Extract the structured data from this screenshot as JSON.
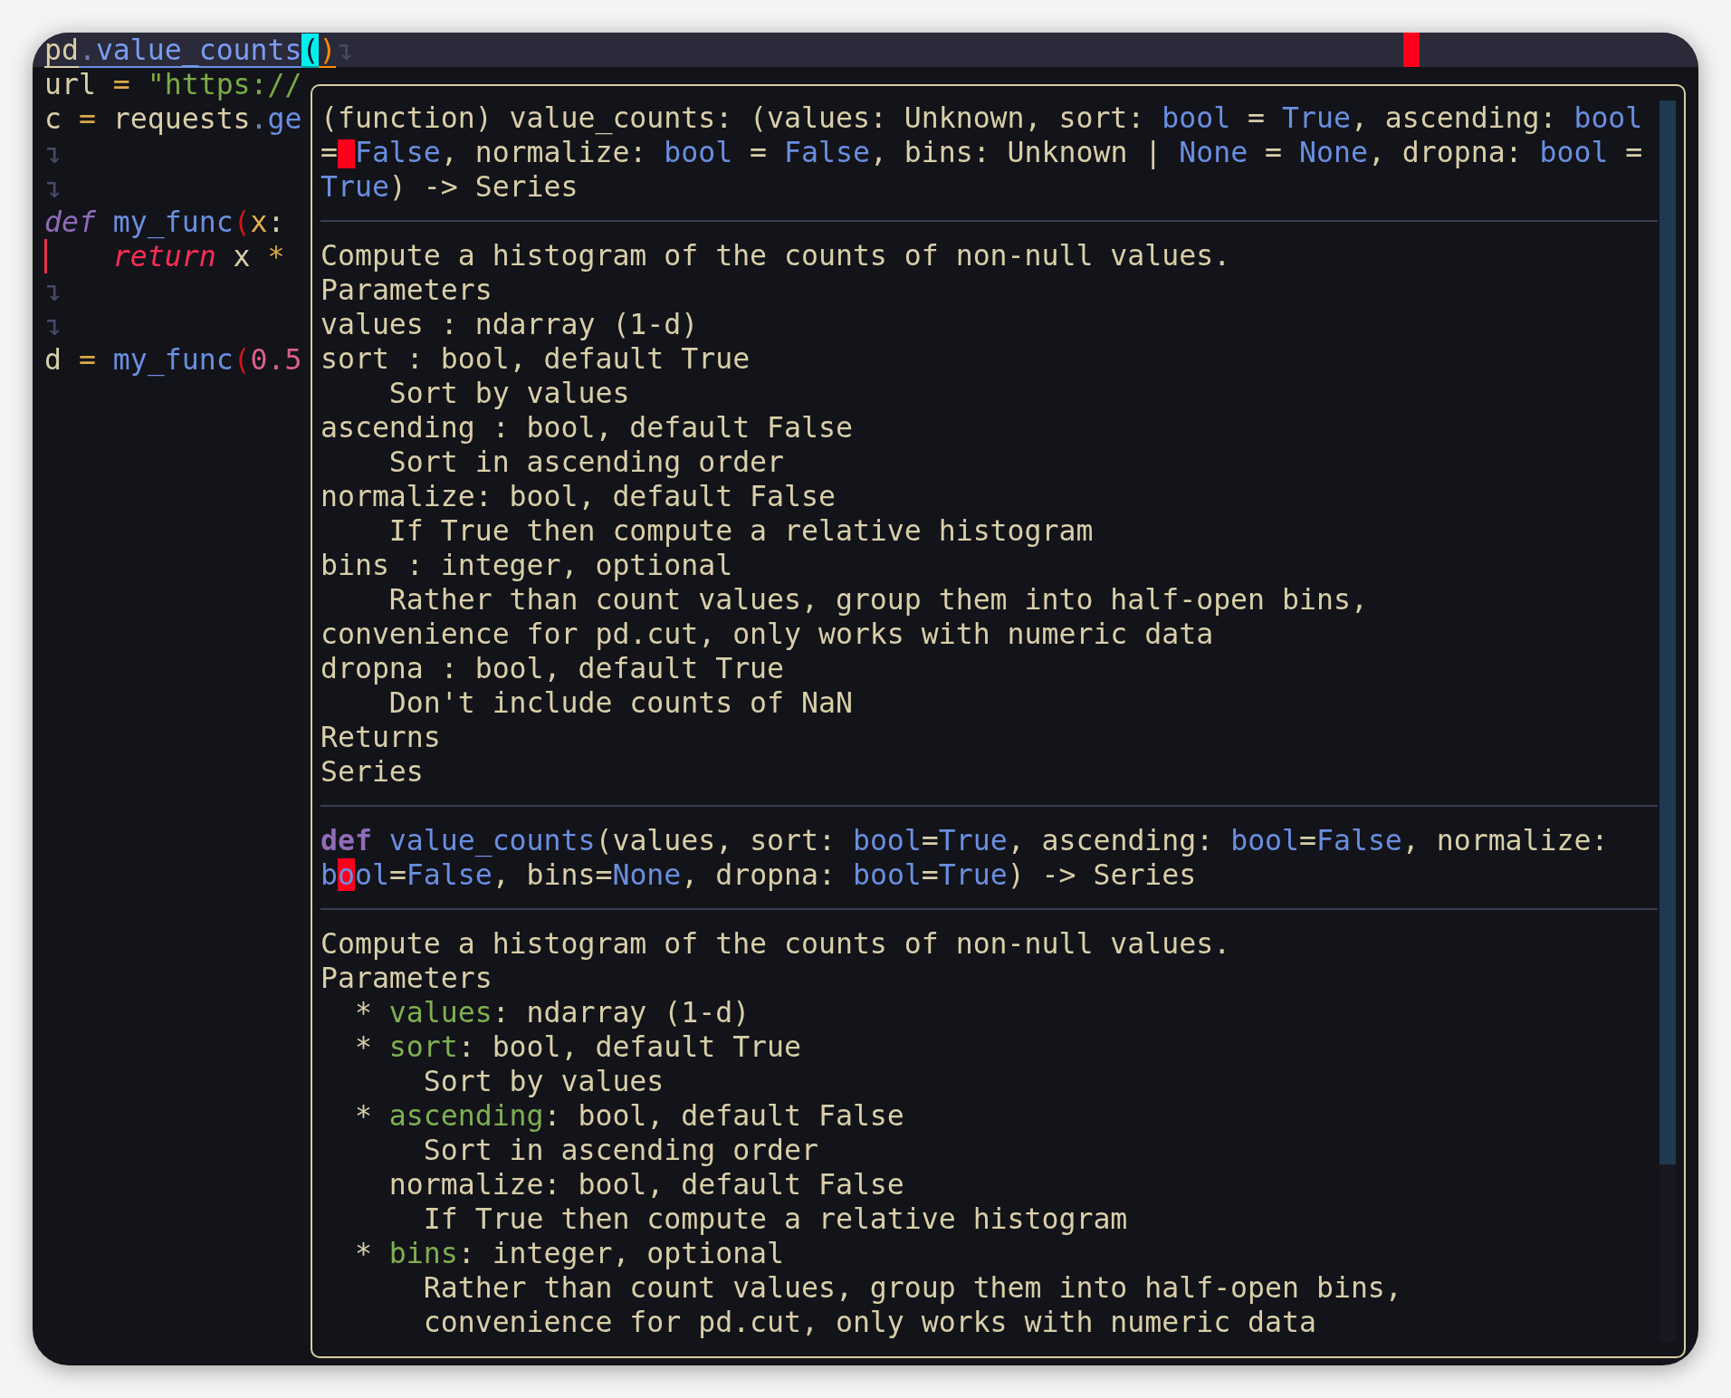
{
  "editor": {
    "current_line": [
      {
        "text": "pd",
        "kind": "ref_module"
      },
      {
        "text": ".",
        "kind": "ref_dot"
      },
      {
        "text": "value_counts",
        "kind": "ref_func"
      },
      {
        "text": "(",
        "kind": "bracket_match"
      },
      {
        "text": ")",
        "kind": "bracket_close"
      },
      {
        "text": "↴",
        "kind": "eol"
      }
    ],
    "lines": [
      {
        "gutter_mark": false,
        "tokens": [
          {
            "text": "url ",
            "kind": "text"
          },
          {
            "text": "=",
            "kind": "operator"
          },
          {
            "text": " \"https://",
            "kind": "string"
          }
        ]
      },
      {
        "gutter_mark": false,
        "tokens": [
          {
            "text": "c ",
            "kind": "text"
          },
          {
            "text": "=",
            "kind": "operator"
          },
          {
            "text": " requests",
            "kind": "text"
          },
          {
            "text": ".",
            "kind": "dot"
          },
          {
            "text": "ge",
            "kind": "func"
          }
        ]
      },
      {
        "gutter_mark": false,
        "tokens": [
          {
            "text": "↴",
            "kind": "eol"
          }
        ]
      },
      {
        "gutter_mark": false,
        "tokens": [
          {
            "text": "↴",
            "kind": "eol"
          }
        ]
      },
      {
        "gutter_mark": false,
        "tokens": [
          {
            "text": "def",
            "kind": "keyword_def"
          },
          {
            "text": " my_func",
            "kind": "func"
          },
          {
            "text": "(",
            "kind": "paren"
          },
          {
            "text": "x",
            "kind": "variable"
          },
          {
            "text": ":",
            "kind": "text"
          }
        ]
      },
      {
        "gutter_mark": true,
        "tokens": [
          {
            "text": "    return",
            "kind": "keyword_return"
          },
          {
            "text": " x ",
            "kind": "text"
          },
          {
            "text": "*",
            "kind": "operator"
          }
        ]
      },
      {
        "gutter_mark": false,
        "tokens": [
          {
            "text": "↴",
            "kind": "eol"
          }
        ]
      },
      {
        "gutter_mark": false,
        "tokens": [
          {
            "text": "↴",
            "kind": "eol"
          }
        ]
      },
      {
        "gutter_mark": false,
        "tokens": [
          {
            "text": "d ",
            "kind": "text"
          },
          {
            "text": "=",
            "kind": "operator"
          },
          {
            "text": " my_func",
            "kind": "func"
          },
          {
            "text": "(",
            "kind": "paren"
          },
          {
            "text": "0.5",
            "kind": "number"
          }
        ]
      }
    ]
  },
  "hover_popup": {
    "signature": [
      [
        {
          "text": "(function) value_counts: (values: Unknown, sort: ",
          "kind": "text"
        },
        {
          "text": "bool",
          "kind": "type"
        },
        {
          "text": " = ",
          "kind": "text"
        },
        {
          "text": "True",
          "kind": "type"
        },
        {
          "text": ", ascending: ",
          "kind": "text"
        },
        {
          "text": "bool",
          "kind": "type"
        }
      ],
      [
        {
          "text": "=",
          "kind": "text"
        },
        {
          "kind": "cursor_block"
        },
        {
          "text": "False",
          "kind": "type"
        },
        {
          "text": ", normalize: ",
          "kind": "text"
        },
        {
          "text": "bool",
          "kind": "type"
        },
        {
          "text": " = ",
          "kind": "text"
        },
        {
          "text": "False",
          "kind": "type"
        },
        {
          "text": ", bins: Unknown | ",
          "kind": "text"
        },
        {
          "text": "None",
          "kind": "type"
        },
        {
          "text": " = ",
          "kind": "text"
        },
        {
          "text": "None",
          "kind": "type"
        },
        {
          "text": ", dropna: ",
          "kind": "text"
        },
        {
          "text": "bool",
          "kind": "type"
        },
        {
          "text": " =",
          "kind": "text"
        }
      ],
      [
        {
          "text": "True",
          "kind": "type"
        },
        {
          "text": ") -> Series",
          "kind": "text"
        }
      ]
    ],
    "description": [
      "Compute a histogram of the counts of non-null values.",
      "Parameters",
      "values : ndarray (1-d)",
      "sort : bool, default True",
      "    Sort by values",
      "ascending : bool, default False",
      "    Sort in ascending order",
      "normalize: bool, default False",
      "    If True then compute a relative histogram",
      "bins : integer, optional",
      "    Rather than count values, group them into half-open bins,",
      "convenience for pd.cut, only works with numeric data",
      "dropna : bool, default True",
      "    Don't include counts of NaN",
      "Returns",
      "Series"
    ],
    "definition": [
      [
        {
          "text": "def",
          "kind": "keyword_bold"
        },
        {
          "text": " value_counts",
          "kind": "func"
        },
        {
          "text": "(values, sort: ",
          "kind": "text"
        },
        {
          "text": "bool",
          "kind": "type"
        },
        {
          "text": "=",
          "kind": "text"
        },
        {
          "text": "True",
          "kind": "type"
        },
        {
          "text": ", ascending: ",
          "kind": "text"
        },
        {
          "text": "bool",
          "kind": "type"
        },
        {
          "text": "=",
          "kind": "text"
        },
        {
          "text": "False",
          "kind": "type"
        },
        {
          "text": ", normalize:",
          "kind": "text"
        }
      ],
      [
        {
          "text": "b",
          "kind": "type"
        },
        {
          "text": "o",
          "kind": "cursor"
        },
        {
          "text": "ol",
          "kind": "type"
        },
        {
          "text": "=",
          "kind": "text"
        },
        {
          "text": "False",
          "kind": "type"
        },
        {
          "text": ", bins=",
          "kind": "text"
        },
        {
          "text": "None",
          "kind": "type"
        },
        {
          "text": ", dropna: ",
          "kind": "text"
        },
        {
          "text": "bool",
          "kind": "type"
        },
        {
          "text": "=",
          "kind": "text"
        },
        {
          "text": "True",
          "kind": "type"
        },
        {
          "text": ") -> Series",
          "kind": "text"
        }
      ]
    ],
    "docstring": [
      [
        {
          "text": "Compute a histogram of the counts of non-null values.",
          "kind": "text"
        }
      ],
      [
        {
          "text": "Parameters",
          "kind": "text"
        }
      ],
      [
        {
          "text": "  * ",
          "kind": "text"
        },
        {
          "text": "values",
          "kind": "param"
        },
        {
          "text": ": ndarray (1-d)",
          "kind": "text"
        }
      ],
      [
        {
          "text": "  * ",
          "kind": "text"
        },
        {
          "text": "sort",
          "kind": "param"
        },
        {
          "text": ": bool, default True",
          "kind": "text"
        }
      ],
      [
        {
          "text": "      Sort by values",
          "kind": "text"
        }
      ],
      [
        {
          "text": "  * ",
          "kind": "text"
        },
        {
          "text": "ascending",
          "kind": "param"
        },
        {
          "text": ": bool, default False",
          "kind": "text"
        }
      ],
      [
        {
          "text": "      Sort in ascending order",
          "kind": "text"
        }
      ],
      [
        {
          "text": "    normalize: bool, default False",
          "kind": "text"
        }
      ],
      [
        {
          "text": "      If True then compute a relative histogram",
          "kind": "text"
        }
      ],
      [
        {
          "text": "  * ",
          "kind": "text"
        },
        {
          "text": "bins",
          "kind": "param"
        },
        {
          "text": ": integer, optional",
          "kind": "text"
        }
      ],
      [
        {
          "text": "      Rather than count values, group them into half-open bins,",
          "kind": "text"
        }
      ],
      [
        {
          "text": "      convenience for pd.cut, only works with numeric data",
          "kind": "text"
        }
      ]
    ]
  }
}
